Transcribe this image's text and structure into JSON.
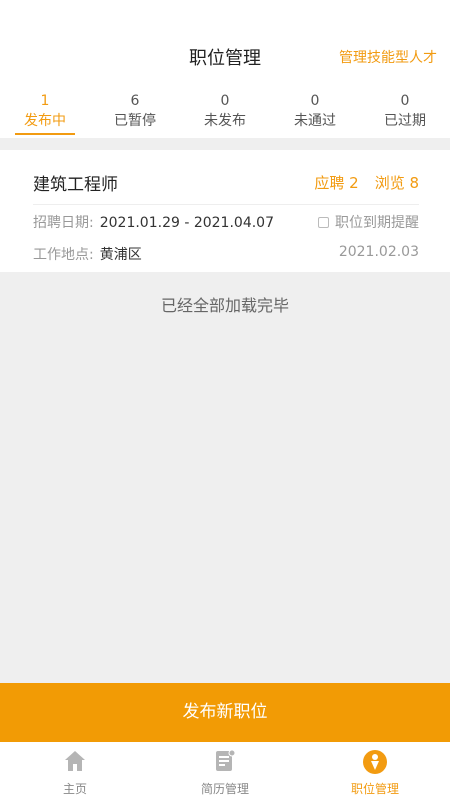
{
  "header": {
    "title": "职位管理",
    "right_link": "管理技能型人才"
  },
  "tabs": [
    {
      "count": "1",
      "label": "发布中",
      "active": true
    },
    {
      "count": "6",
      "label": "已暂停"
    },
    {
      "count": "0",
      "label": "未发布"
    },
    {
      "count": "0",
      "label": "未通过"
    },
    {
      "count": "0",
      "label": "已过期"
    }
  ],
  "job": {
    "title": "建筑工程师",
    "applications": "应聘 2",
    "views": "浏览 8",
    "date_label": "招聘日期:",
    "date_range": "2021.01.29 - 2021.04.07",
    "reminder_label": "职位到期提醒",
    "location_label": "工作地点:",
    "location": "黄浦区",
    "posted_date": "2021.02.03"
  },
  "list_end_text": "已经全部加载完毕",
  "publish_button": "发布新职位",
  "bottom_nav": [
    {
      "label": "主页",
      "icon": "home-icon"
    },
    {
      "label": "简历管理",
      "icon": "resume-icon"
    },
    {
      "label": "职位管理",
      "icon": "job-icon",
      "active": true
    }
  ],
  "colors": {
    "accent": "#f29b11",
    "button": "#f29b05",
    "background": "#efefef"
  }
}
